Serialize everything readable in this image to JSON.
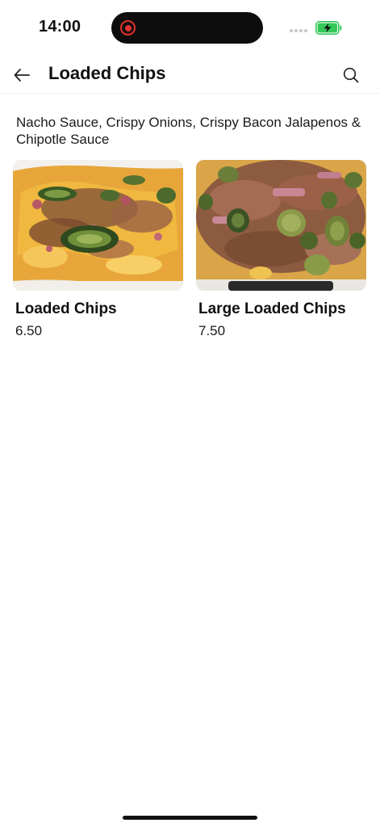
{
  "status_bar": {
    "time": "14:00",
    "recording_icon": "screen-recording-icon",
    "battery_icon": "battery-charging-icon"
  },
  "header": {
    "title": "Loaded Chips",
    "back_icon": "arrow-left-icon",
    "search_icon": "search-icon"
  },
  "category": {
    "description": "Nacho Sauce, Crispy Onions, Crispy Bacon Jalapenos & Chipotle Sauce"
  },
  "products": [
    {
      "name": "Loaded Chips",
      "price": "6.50",
      "image": "loaded-chips-photo"
    },
    {
      "name": "Large Loaded Chips",
      "price": "7.50",
      "image": "large-loaded-chips-photo"
    }
  ],
  "colors": {
    "accent_red": "#e0322e",
    "battery_green": "#34c759",
    "text": "#111111"
  }
}
